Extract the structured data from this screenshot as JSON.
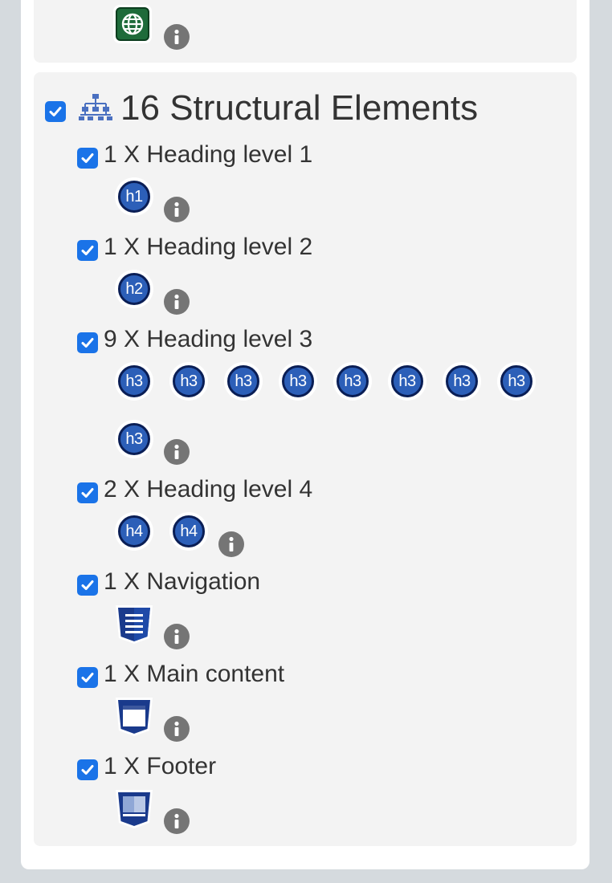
{
  "section": {
    "count": "16",
    "title": "Structural Elements"
  },
  "rows": [
    {
      "label": "1 X Heading level 1",
      "icon_text": "h1"
    },
    {
      "label": "1 X Heading level 2",
      "icon_text": "h2"
    },
    {
      "label": "9 X Heading level 3",
      "icon_text": "h3"
    },
    {
      "label": "2 X Heading level 4",
      "icon_text": "h4"
    },
    {
      "label": "1 X Navigation"
    },
    {
      "label": "1 X Main content"
    },
    {
      "label": "1 X Footer"
    }
  ],
  "icons": {
    "top": "globe-icon",
    "section": "hierarchy-icon",
    "info": "info-icon",
    "navigation": "navigation-shield-icon",
    "main": "main-content-shield-icon",
    "footer": "footer-shield-icon"
  },
  "colors": {
    "checkbox": "#1a73e8",
    "heading_badge": "#2c5fb8",
    "heading_badge_border": "#0a1e55",
    "info": "#757575",
    "globe": "#1e6b3a",
    "shield": "#1a3a8c",
    "card_bg": "#f3f3f3",
    "page_bg": "#d5dade"
  }
}
